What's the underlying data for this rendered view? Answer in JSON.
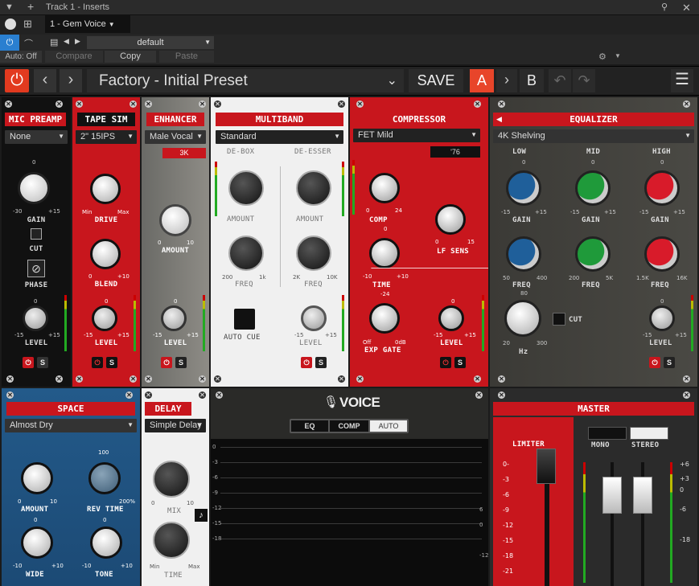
{
  "host": {
    "track_title": "Track 1 - Inserts",
    "insert_name": "1 - Gem Voice",
    "auto_label": "Auto: Off",
    "preset_name": "default",
    "compare_label": "Compare",
    "copy_label": "Copy",
    "paste_label": "Paste"
  },
  "toolbar": {
    "preset": "Factory - Initial Preset",
    "save_label": "SAVE",
    "a_label": "A",
    "b_label": "B"
  },
  "mic_preamp": {
    "title": "MIC PREAMP",
    "select": "None",
    "gain_label": "GAIN",
    "gain_min": "-30",
    "gain_max": "+15",
    "gain_zero": "0",
    "cut_label": "CUT",
    "phase_label": "PHASE",
    "level_label": "LEVEL",
    "level_min": "-15",
    "level_max": "+15",
    "level_zero": "0",
    "s": "S"
  },
  "tape_sim": {
    "title": "TAPE SIM",
    "select": "2\" 15IPS",
    "drive_label": "DRIVE",
    "drive_min": "Min",
    "drive_max": "Max",
    "blend_label": "BLEND",
    "blend_min": "0",
    "blend_max": "+10",
    "level_label": "LEVEL",
    "level_min": "-15",
    "level_max": "+15",
    "level_zero": "0",
    "s": "S"
  },
  "enhancer": {
    "title": "ENHANCER",
    "select": "Male Vocal",
    "freq_readout": "3K",
    "amount_label": "AMOUNT",
    "amount_min": "0",
    "amount_max": "10",
    "level_label": "LEVEL",
    "level_min": "-15",
    "level_max": "+15",
    "level_zero": "0",
    "s": "S"
  },
  "multiband": {
    "title": "MULTIBAND",
    "select": "Standard",
    "debox": "DE-BOX",
    "deesser": "DE-ESSER",
    "amount_label": "AMOUNT",
    "freq_label": "FREQ",
    "freq1_min": "200",
    "freq1_max": "1k",
    "freq2_min": "2K",
    "freq2_max": "10K",
    "autocue": "AUTO CUE",
    "level_label": "LEVEL",
    "level_min": "-15",
    "level_max": "+15",
    "s": "S"
  },
  "compressor": {
    "title": "COMPRESSOR",
    "select": "FET Mild",
    "model": "'76",
    "comp_label": "COMP",
    "comp_min": "0",
    "comp_max": "24",
    "time_label": "TIME",
    "time_min": "-10",
    "time_max": "+10",
    "time_zero": "0",
    "lf_label": "LF SENS",
    "lf_min": "0",
    "lf_max": "15",
    "gate_label": "EXP GATE",
    "gate_min": "Off",
    "gate_max": "0dB",
    "gate_top": "-24",
    "level_label": "LEVEL",
    "level_min": "-15",
    "level_max": "+15",
    "level_zero": "0",
    "s": "S"
  },
  "equalizer": {
    "title": "EQUALIZER",
    "select": "4K Shelving",
    "low": "LOW",
    "mid": "MID",
    "high": "HIGH",
    "gain_label": "GAIN",
    "gain_min": "-15",
    "gain_max": "+15",
    "gain_zero": "0",
    "freq_label": "FREQ",
    "f1_min": "50",
    "f1_max": "400",
    "f2_min": "200",
    "f2_max": "5K",
    "f3_min": "1.5K",
    "f3_max": "16K",
    "hpf_min": "20",
    "hpf_max": "300",
    "hpf_top": "80",
    "hz": "Hz",
    "cut_label": "CUT",
    "level_label": "LEVEL",
    "level_min": "-15",
    "level_max": "+15",
    "level_zero": "0",
    "s": "S"
  },
  "space": {
    "title": "SPACE",
    "select": "Almost Dry",
    "amount_label": "AMOUNT",
    "amount_min": "0",
    "amount_max": "10",
    "rev_label": "REV TIME",
    "rev_top": "100",
    "rev_max": "200%",
    "wide_label": "WIDE",
    "wide_min": "-10",
    "wide_max": "+10",
    "wide_zero": "0",
    "tone_label": "TONE",
    "tone_min": "-10",
    "tone_max": "+10",
    "tone_zero": "0"
  },
  "delay": {
    "title": "DELAY",
    "select": "Simple Delay",
    "mix_label": "MIX",
    "mix_min": "0",
    "mix_max": "10",
    "time_label": "TIME",
    "time_min": "Min",
    "time_max": "Max"
  },
  "voice": {
    "logo": "VOICE",
    "tab_eq": "EQ",
    "tab_comp": "COMP",
    "tab_auto": "AUTO",
    "scale": [
      "0",
      "-3",
      "-6",
      "-9",
      "-12",
      "-15",
      "-18"
    ],
    "right_scale": [
      "6",
      "0",
      "-12"
    ]
  },
  "master": {
    "title": "MASTER",
    "limiter": "LIMITER",
    "mono": "MONO",
    "stereo": "STEREO",
    "left_scale": [
      "0-",
      "-3",
      "-6",
      "-9",
      "-12",
      "-15",
      "-18",
      "-21"
    ],
    "right_scale": [
      "+6",
      "+3",
      "0",
      "-6",
      "-18"
    ]
  }
}
